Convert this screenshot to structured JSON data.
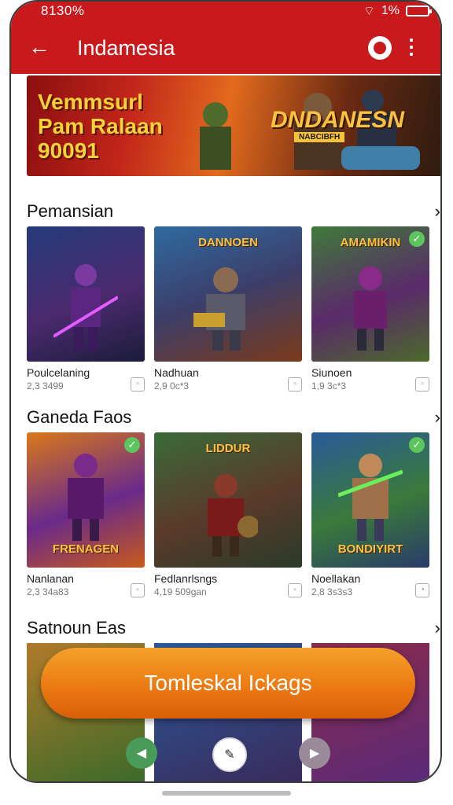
{
  "status": {
    "time": "8130%",
    "battery": "1%"
  },
  "header": {
    "title": "Indamesia"
  },
  "banner": {
    "line1": "Vemmsurl",
    "line2": "Pam Ralaan",
    "line3": "90091",
    "logo": "DNDANESN",
    "subtitle": "NABCIBFH"
  },
  "sections": [
    {
      "title": "Pemansian",
      "cards": [
        {
          "thumb_title": "",
          "name": "Poulcelaning",
          "meta": "2,3 3499",
          "checked": false
        },
        {
          "thumb_title": "DANNOEN",
          "name": "Nadhuan",
          "meta": "2,9 0c*3",
          "checked": false
        },
        {
          "thumb_title": "AMAMIKIN",
          "name": "Siunoen",
          "meta": "1,9 3c*3",
          "checked": true
        }
      ]
    },
    {
      "title": "Ganeda Faos",
      "cards": [
        {
          "thumb_title": "FRENAGEN",
          "name": "Nanlanan",
          "meta": "2,3 34a83",
          "checked": true
        },
        {
          "thumb_title": "LIDDUR",
          "name": "Fedlanrlsngs",
          "meta": "4,19 509gan",
          "checked": false
        },
        {
          "thumb_title": "BONDIYIRT",
          "name": "Noellakan",
          "meta": "2,8 3s3s3",
          "checked": true
        }
      ]
    },
    {
      "title": "Satnoun Eas"
    }
  ],
  "cta": {
    "label": "Tomleskal Ickags"
  },
  "colors": {
    "primary": "#c8191c",
    "cta": "#ec7a13",
    "check": "#5ec45e"
  }
}
